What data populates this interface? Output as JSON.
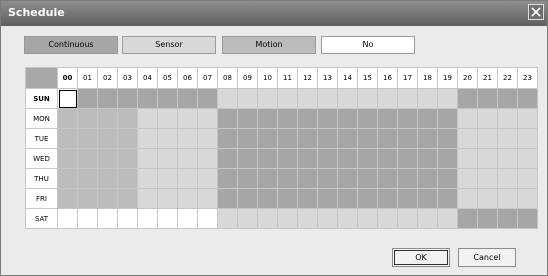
{
  "window": {
    "title": "Schedule",
    "close_icon": "close-icon"
  },
  "legend": [
    {
      "label": "Continuous",
      "color": "#a6a6a6"
    },
    {
      "label": "Sensor",
      "color": "#d8d8d8"
    },
    {
      "label": "Motion",
      "color": "#bcbcbc"
    },
    {
      "label": "No",
      "color": "#ffffff"
    }
  ],
  "grid": {
    "hours": [
      "00",
      "01",
      "02",
      "03",
      "04",
      "05",
      "06",
      "07",
      "08",
      "09",
      "10",
      "11",
      "12",
      "13",
      "14",
      "15",
      "16",
      "17",
      "18",
      "19",
      "20",
      "21",
      "22",
      "23"
    ],
    "selected_hour": "00",
    "selected_day": "SUN",
    "rows": [
      {
        "day": "SUN",
        "cells": [
          "No",
          "Continuous",
          "Continuous",
          "Continuous",
          "Continuous",
          "Continuous",
          "Continuous",
          "Continuous",
          "Sensor",
          "Sensor",
          "Sensor",
          "Sensor",
          "Sensor",
          "Sensor",
          "Sensor",
          "Sensor",
          "Sensor",
          "Sensor",
          "Sensor",
          "Sensor",
          "Continuous",
          "Continuous",
          "Continuous",
          "Continuous"
        ]
      },
      {
        "day": "MON",
        "cells": [
          "Motion",
          "Motion",
          "Motion",
          "Motion",
          "Sensor",
          "Sensor",
          "Sensor",
          "Sensor",
          "Continuous",
          "Continuous",
          "Continuous",
          "Continuous",
          "Continuous",
          "Continuous",
          "Continuous",
          "Continuous",
          "Continuous",
          "Continuous",
          "Continuous",
          "Continuous",
          "Sensor",
          "Sensor",
          "Sensor",
          "Sensor"
        ]
      },
      {
        "day": "TUE",
        "cells": [
          "Motion",
          "Motion",
          "Motion",
          "Motion",
          "Sensor",
          "Sensor",
          "Sensor",
          "Sensor",
          "Continuous",
          "Continuous",
          "Continuous",
          "Continuous",
          "Continuous",
          "Continuous",
          "Continuous",
          "Continuous",
          "Continuous",
          "Continuous",
          "Continuous",
          "Continuous",
          "Sensor",
          "Sensor",
          "Sensor",
          "Sensor"
        ]
      },
      {
        "day": "WED",
        "cells": [
          "Motion",
          "Motion",
          "Motion",
          "Motion",
          "Sensor",
          "Sensor",
          "Sensor",
          "Sensor",
          "Continuous",
          "Continuous",
          "Continuous",
          "Continuous",
          "Continuous",
          "Continuous",
          "Continuous",
          "Continuous",
          "Continuous",
          "Continuous",
          "Continuous",
          "Continuous",
          "Sensor",
          "Sensor",
          "Sensor",
          "Sensor"
        ]
      },
      {
        "day": "THU",
        "cells": [
          "Motion",
          "Motion",
          "Motion",
          "Motion",
          "Sensor",
          "Sensor",
          "Sensor",
          "Sensor",
          "Continuous",
          "Continuous",
          "Continuous",
          "Continuous",
          "Continuous",
          "Continuous",
          "Continuous",
          "Continuous",
          "Continuous",
          "Continuous",
          "Continuous",
          "Continuous",
          "Sensor",
          "Sensor",
          "Sensor",
          "Sensor"
        ]
      },
      {
        "day": "FRI",
        "cells": [
          "Motion",
          "Motion",
          "Motion",
          "Motion",
          "Sensor",
          "Sensor",
          "Sensor",
          "Sensor",
          "Continuous",
          "Continuous",
          "Continuous",
          "Continuous",
          "Continuous",
          "Continuous",
          "Continuous",
          "Continuous",
          "Continuous",
          "Continuous",
          "Continuous",
          "Continuous",
          "Sensor",
          "Sensor",
          "Sensor",
          "Sensor"
        ]
      },
      {
        "day": "SAT",
        "cells": [
          "No",
          "No",
          "No",
          "No",
          "No",
          "No",
          "No",
          "No",
          "Sensor",
          "Sensor",
          "Sensor",
          "Sensor",
          "Sensor",
          "Sensor",
          "Sensor",
          "Sensor",
          "Sensor",
          "Sensor",
          "Sensor",
          "Sensor",
          "Continuous",
          "Continuous",
          "Continuous",
          "Continuous"
        ]
      }
    ]
  },
  "buttons": {
    "ok": "OK",
    "cancel": "Cancel"
  }
}
